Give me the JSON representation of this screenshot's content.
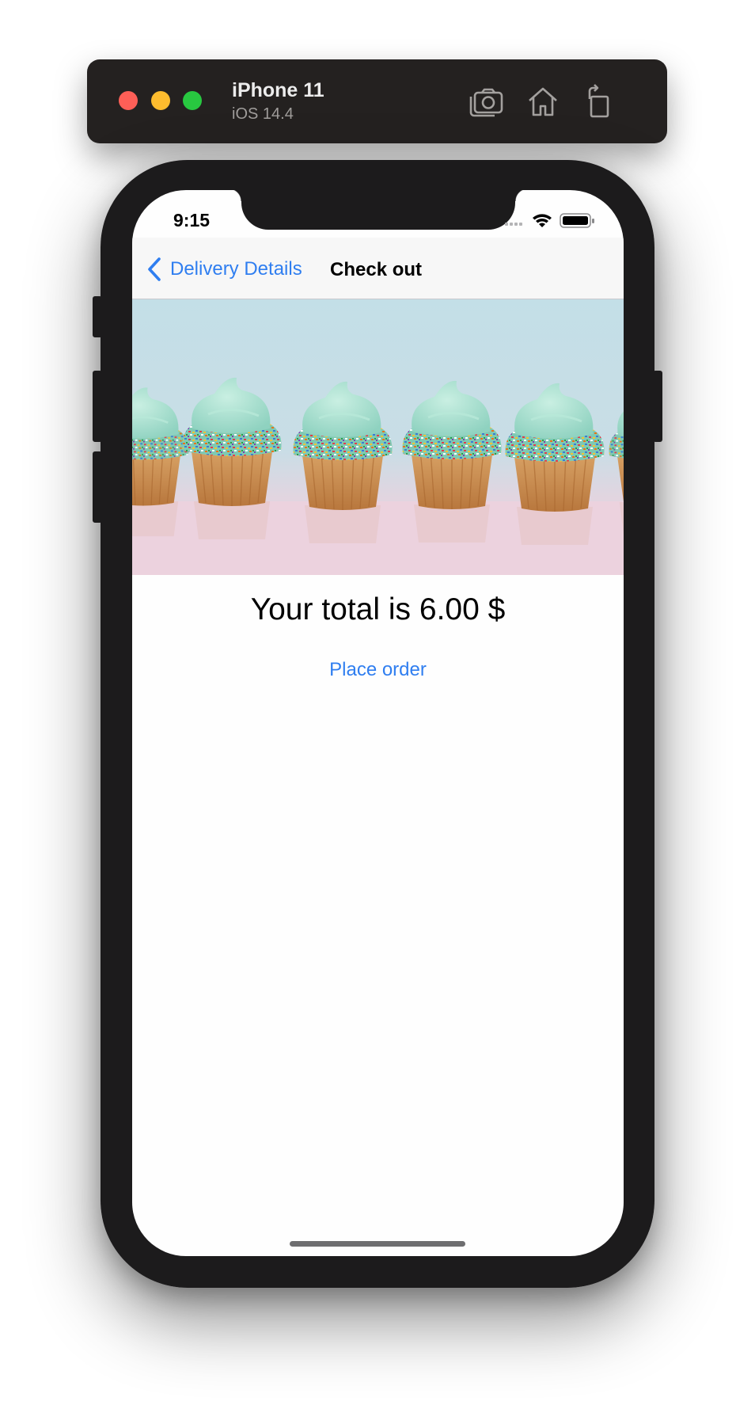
{
  "simulator": {
    "device_name": "iPhone 11",
    "os_version": "iOS 14.4",
    "icons": [
      "screenshot-icon",
      "home-icon",
      "rotate-icon"
    ]
  },
  "status_bar": {
    "time": "9:15",
    "icons": [
      "cellular-icon",
      "wifi-icon",
      "battery-icon"
    ]
  },
  "navbar": {
    "back_label": "Delivery Details",
    "title": "Check out"
  },
  "content": {
    "hero_image": "cupcakes-banner",
    "total_text": "Your total is 6.00 $",
    "place_order_label": "Place order"
  },
  "colors": {
    "tint": "#2f7ef0",
    "toolbar": "#242120",
    "bezel": "#1c1b1c"
  }
}
